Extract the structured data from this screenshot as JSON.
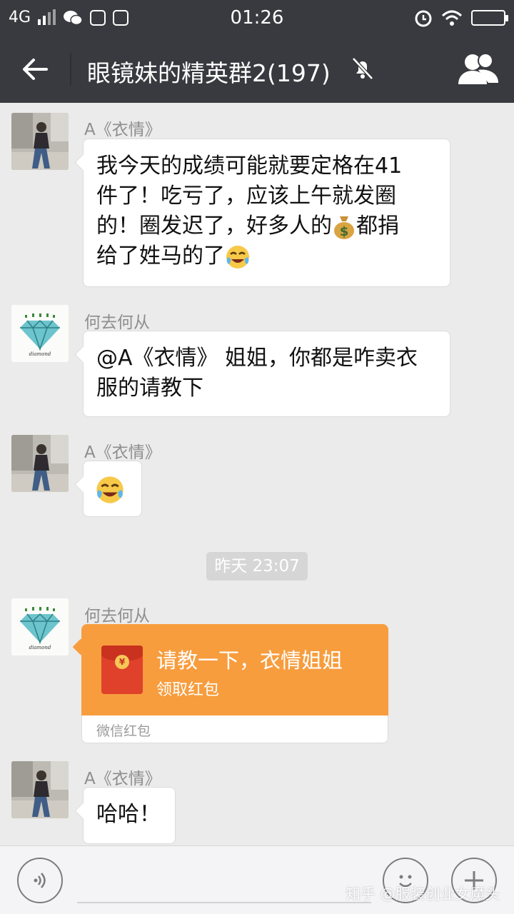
{
  "status_bar": {
    "network": "4G",
    "time": "01:26",
    "icons": [
      "signal-icon",
      "wechat-icon",
      "shopping-bag-icon",
      "mail-icon",
      "alarm-icon",
      "wifi-icon",
      "battery-icon"
    ]
  },
  "header": {
    "title": "眼镜妹的精英群2(197)",
    "back_icon": "back-arrow-icon",
    "mute_icon": "mute-bell-icon",
    "group_icon": "group-members-icon",
    "background": "#393a3f"
  },
  "messages": [
    {
      "sender": "A《衣情》",
      "avatar": "person-photo-avatar",
      "lines": [
        "我今天的成绩可能就要定格在41",
        "件了！吃亏了，应该上午就发圈",
        "的！圈发迟了，好多人的",
        "都捐",
        "给了姓马的了"
      ],
      "emojis": [
        "money-bag-emoji",
        "crying-laughing-emoji"
      ]
    },
    {
      "sender": "何去何从",
      "avatar": "diamond-avatar",
      "lines": [
        "@A《衣情》 姐姐，你都是咋卖衣",
        "服的请教下"
      ]
    },
    {
      "sender": "A《衣情》",
      "avatar": "person-photo-avatar",
      "emojis": [
        "crying-laughing-emoji"
      ]
    },
    {
      "sender": "何去何从",
      "avatar": "diamond-avatar",
      "red_packet": {
        "title": "请教一下，衣情姐姐",
        "action": "领取红包",
        "footer": "微信红包",
        "color": "#f79d3e"
      }
    },
    {
      "sender": "A《衣情》",
      "avatar": "person-photo-avatar",
      "lines": [
        "哈哈！"
      ]
    }
  ],
  "timestamp": "昨天 23:07",
  "input_bar": {
    "voice_icon": "voice-input-icon",
    "emoji_icon": "emoji-face-icon",
    "plus_icon": "plus-icon"
  },
  "watermark": "知乎 @服装创业女魔头"
}
